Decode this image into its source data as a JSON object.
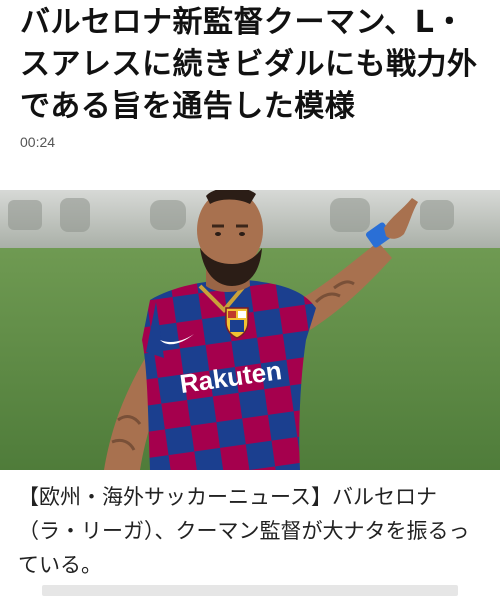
{
  "article": {
    "headline": "バルセロナ新監督クーマン、L・スアレスに続きビダルにも戦力外である旨を通告した模様",
    "time": "00:24",
    "image": {
      "sponsor_text": "Rakuten"
    },
    "lede": "【欧州・海外サッカーニュース】バルセロナ（ラ・リーガ）、クーマン監督が大ナタを振るっている。"
  },
  "colors": {
    "kit_blue": "#1b3f8f",
    "kit_red": "#a5004d",
    "pitch_green": "#5e8a45",
    "captain_band": "#2a6fd6"
  }
}
